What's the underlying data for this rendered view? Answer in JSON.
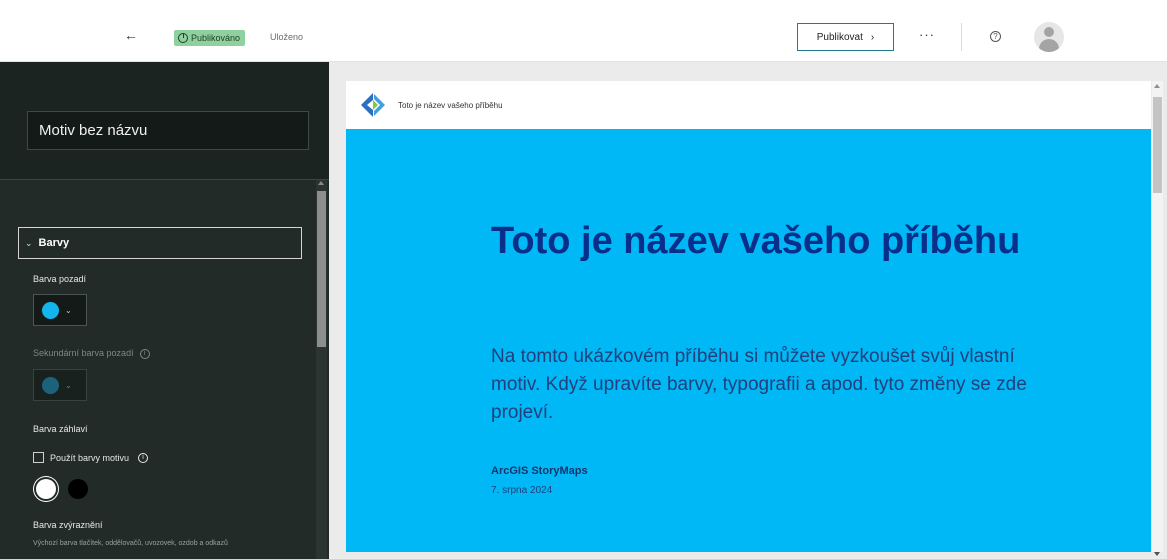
{
  "topbar": {
    "back_icon": "←",
    "status_badge": "Publikováno",
    "saved_label": "Uloženo",
    "publish_label": "Publikovat",
    "publish_chevron": "›",
    "more_label": "···",
    "help_icon": "?"
  },
  "left_panel": {
    "theme_name": "Motiv bez názvu",
    "section": {
      "chevron": "⌄",
      "label": "Barvy"
    },
    "fields": {
      "background_label": "Barva pozadí",
      "background_color": "#12b5ee",
      "secondary_label": "Sekundární barva pozadí",
      "secondary_color": "#1a8fbf",
      "header_label": "Barva záhlaví",
      "use_theme_colors_label": "Použít barvy motivu",
      "accent_label": "Barva zvýraznění",
      "accent_description": "Výchozí barva tlačítek, oddělovačů, uvozovek, ozdob a odkazů"
    },
    "info_icon": "i",
    "dropdown_icon": "⌄"
  },
  "preview": {
    "header_title": "Toto je název vašeho příběhu",
    "title": "Toto je název vašeho příběhu",
    "subtitle": "Na tomto ukázkovém příběhu si můžete vyzkoušet svůj vlastní motiv. Když upravíte barvy, typografii a apod. tyto změny se zde projeví.",
    "author": "ArcGIS StoryMaps",
    "date": "7. srpna 2024",
    "background_color": "#00b8f5",
    "title_color": "#0a2f8a"
  }
}
